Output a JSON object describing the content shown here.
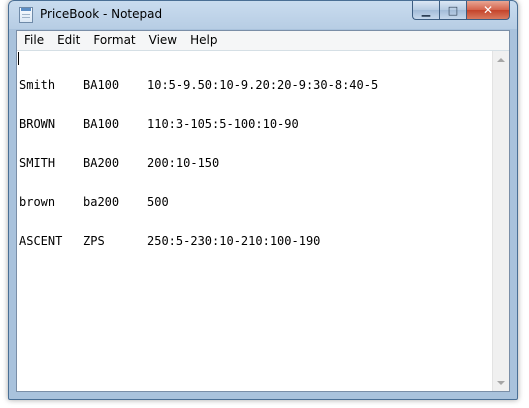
{
  "window": {
    "title": "PriceBook - Notepad",
    "app_icon": "notepad-icon",
    "caption_buttons": {
      "minimize_icon": "minimize-icon",
      "maximize_icon": "maximize-icon",
      "close_icon": "close-icon",
      "minimize_glyph": "▁",
      "maximize_glyph": "□",
      "close_glyph": "✕"
    },
    "colors": {
      "frame": "#a9c2dc",
      "close_button": "#c4432a"
    }
  },
  "menu": {
    "items": [
      "File",
      "Edit",
      "Format",
      "View",
      "Help"
    ]
  },
  "document": {
    "lines": [
      {
        "name": "Smith",
        "code": "BA100",
        "prices": "10:5-9.50:10-9.20:20-9:30-8:40-5"
      },
      {
        "name": "BROWN",
        "code": "BA100",
        "prices": "110:3-105:5-100:10-90"
      },
      {
        "name": "SMITH",
        "code": "BA200",
        "prices": "200:10-150"
      },
      {
        "name": "brown",
        "code": "ba200",
        "prices": "500"
      },
      {
        "name": "ASCENT",
        "code": "ZPS",
        "prices": "250:5-230:10-210:100-190"
      }
    ]
  },
  "scrollbar": {
    "up_icon": "scroll-up-arrow-icon",
    "down_icon": "scroll-down-arrow-icon"
  }
}
